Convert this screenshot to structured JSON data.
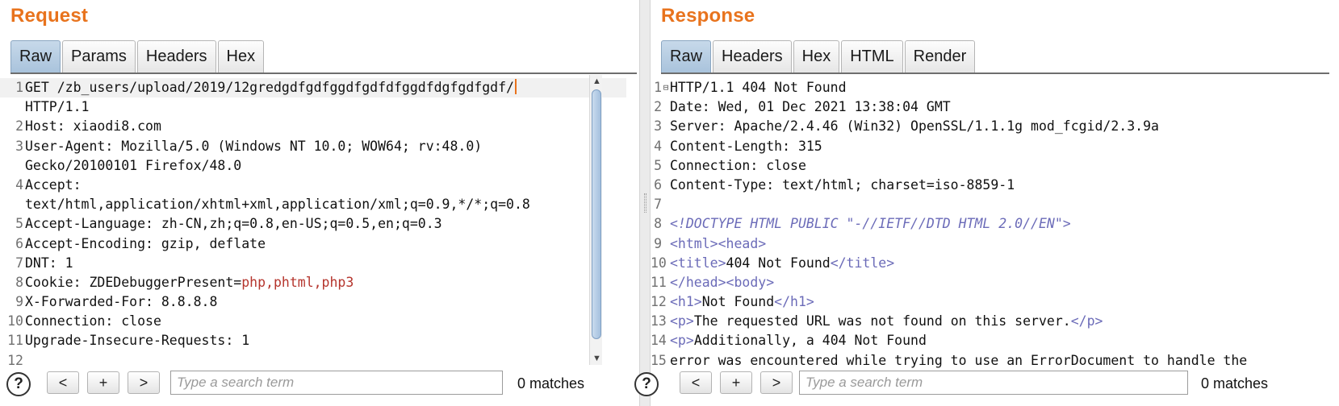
{
  "request": {
    "title": "Request",
    "tabs": [
      "Raw",
      "Params",
      "Headers",
      "Hex"
    ],
    "active_tab": "Raw",
    "lines": [
      {
        "n": "1",
        "key": "GET /zb_users/upload/2019/12gredgdfgdfggdfgdfdfggdfdgfgdfgdf",
        "val": "/",
        "val_color": "cursor"
      },
      {
        "n": "",
        "key": "HTTP/1.1",
        "val": ""
      },
      {
        "n": "2",
        "key": "Host: xiaodi8.com",
        "val": ""
      },
      {
        "n": "3",
        "key": "User-Agent: Mozilla/5.0 (Windows NT 10.0; WOW64; rv:48.0)",
        "val": ""
      },
      {
        "n": "",
        "key": "Gecko/20100101 Firefox/48.0",
        "val": ""
      },
      {
        "n": "4",
        "key": "Accept:",
        "val": ""
      },
      {
        "n": "",
        "key": "text/html,application/xhtml+xml,application/xml;q=0.9,*/*;q=0.8",
        "val": ""
      },
      {
        "n": "5",
        "key": "Accept-Language: zh-CN,zh;q=0.8,en-US;q=0.5,en;q=0.3",
        "val": ""
      },
      {
        "n": "6",
        "key": "Accept-Encoding: gzip, deflate",
        "val": ""
      },
      {
        "n": "7",
        "key": "DNT: 1",
        "val": ""
      },
      {
        "n": "8",
        "key": "Cookie: ZDEDebuggerPresent=",
        "val": "php,phtml,php3",
        "val_color": "red"
      },
      {
        "n": "9",
        "key": "X-Forwarded-For: 8.8.8.8",
        "val": ""
      },
      {
        "n": "10",
        "key": "Connection: close",
        "val": ""
      },
      {
        "n": "11",
        "key": "Upgrade-Insecure-Requests: 1",
        "val": ""
      },
      {
        "n": "12",
        "key": "",
        "val": ""
      }
    ],
    "search": {
      "help": "?",
      "prev": "<",
      "plus": "+",
      "next": ">",
      "placeholder": "Type a search term",
      "matches": "0 matches"
    }
  },
  "response": {
    "title": "Response",
    "tabs": [
      "Raw",
      "Headers",
      "Hex",
      "HTML",
      "Render"
    ],
    "active_tab": "Raw",
    "lines": [
      {
        "n": "1",
        "fold": "⊟",
        "text": "HTTP/1.1 404 Not Found",
        "style": "plain"
      },
      {
        "n": "2",
        "text": "Date: Wed, 01 Dec 2021 13:38:04 GMT",
        "style": "plain"
      },
      {
        "n": "3",
        "text": "Server: Apache/2.4.46 (Win32) OpenSSL/1.1.1g mod_fcgid/2.3.9a",
        "style": "plain"
      },
      {
        "n": "4",
        "text": "Content-Length: 315",
        "style": "plain"
      },
      {
        "n": "5",
        "text": "Connection: close",
        "style": "plain"
      },
      {
        "n": "6",
        "text": "Content-Type: text/html; charset=iso-8859-1",
        "style": "plain"
      },
      {
        "n": "7",
        "text": "",
        "style": "plain"
      },
      {
        "n": "8",
        "text": "<!DOCTYPE HTML PUBLIC \"-//IETF//DTD HTML 2.0//EN\">",
        "style": "doctype"
      },
      {
        "n": "9",
        "parts": [
          [
            "tag",
            "<html>"
          ],
          [
            "tag",
            "<head>"
          ]
        ]
      },
      {
        "n": "10",
        "parts": [
          [
            "tag",
            "<title>"
          ],
          [
            "plain",
            "404 Not Found"
          ],
          [
            "tag",
            "</title>"
          ]
        ]
      },
      {
        "n": "11",
        "parts": [
          [
            "tag",
            "</head>"
          ],
          [
            "tag",
            "<body>"
          ]
        ]
      },
      {
        "n": "12",
        "parts": [
          [
            "tag",
            "<h1>"
          ],
          [
            "plain",
            "Not Found"
          ],
          [
            "tag",
            "</h1>"
          ]
        ]
      },
      {
        "n": "13",
        "parts": [
          [
            "tag",
            "<p>"
          ],
          [
            "plain",
            "The requested URL was not found on this server."
          ],
          [
            "tag",
            "</p>"
          ]
        ]
      },
      {
        "n": "14",
        "parts": [
          [
            "tag",
            "<p>"
          ],
          [
            "plain",
            "Additionally, a 404 Not Found"
          ]
        ]
      },
      {
        "n": "15",
        "text": "error was encountered while trying to use an ErrorDocument to handle the",
        "style": "plain"
      }
    ],
    "search": {
      "help": "?",
      "prev": "<",
      "plus": "+",
      "next": ">",
      "placeholder": "Type a search term",
      "matches": "0 matches"
    }
  }
}
